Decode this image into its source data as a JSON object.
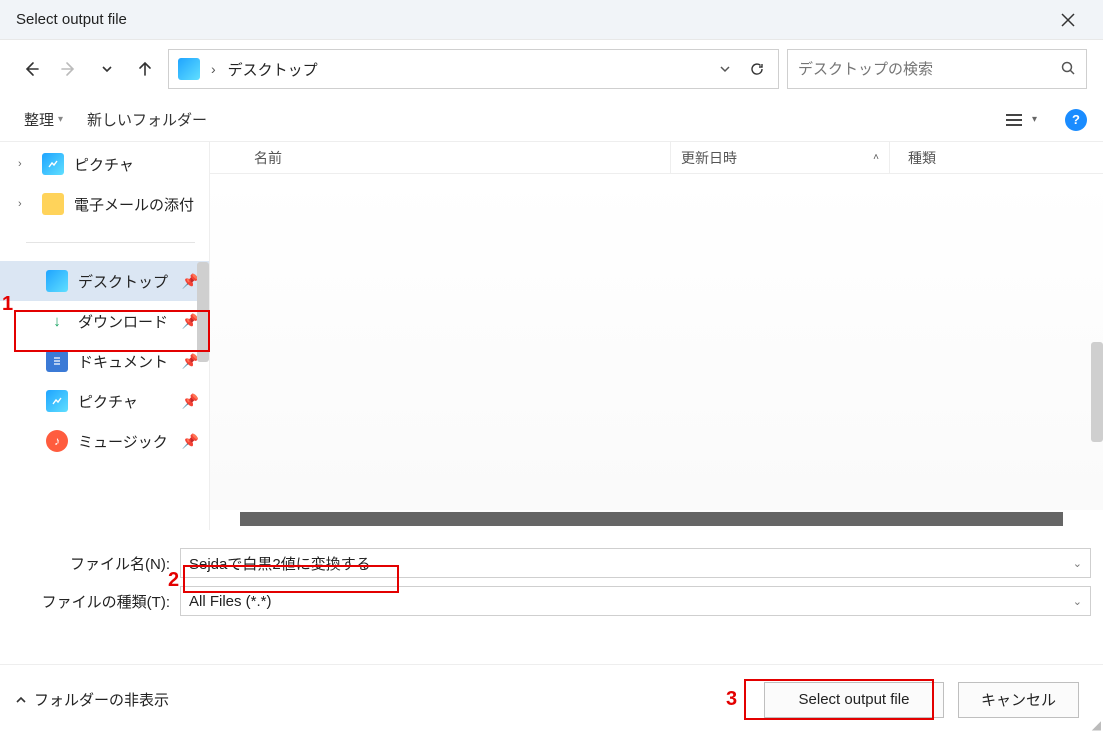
{
  "window": {
    "title": "Select output file"
  },
  "addressbar": {
    "location": "デスクトップ"
  },
  "search": {
    "placeholder": "デスクトップの検索"
  },
  "toolbar": {
    "organize": "整理",
    "new_folder": "新しいフォルダー"
  },
  "sidebar": {
    "pictures_top": "ピクチャ",
    "email_attach": "電子メールの添付",
    "desktop": "デスクトップ",
    "downloads": "ダウンロード",
    "documents": "ドキュメント",
    "pictures": "ピクチャ",
    "music": "ミュージック"
  },
  "columns": {
    "name": "名前",
    "date": "更新日時",
    "type": "種類"
  },
  "form": {
    "filename_label": "ファイル名(N):",
    "filename_value": "Sejdaで白黒2値に変換する",
    "filetype_label": "ファイルの種類(T):",
    "filetype_value": "All Files (*.*)"
  },
  "footer": {
    "hide_folders": "フォルダーの非表示",
    "select": "Select output file",
    "cancel": "キャンセル"
  },
  "annotations": {
    "a1": "1",
    "a2": "2",
    "a3": "3"
  }
}
